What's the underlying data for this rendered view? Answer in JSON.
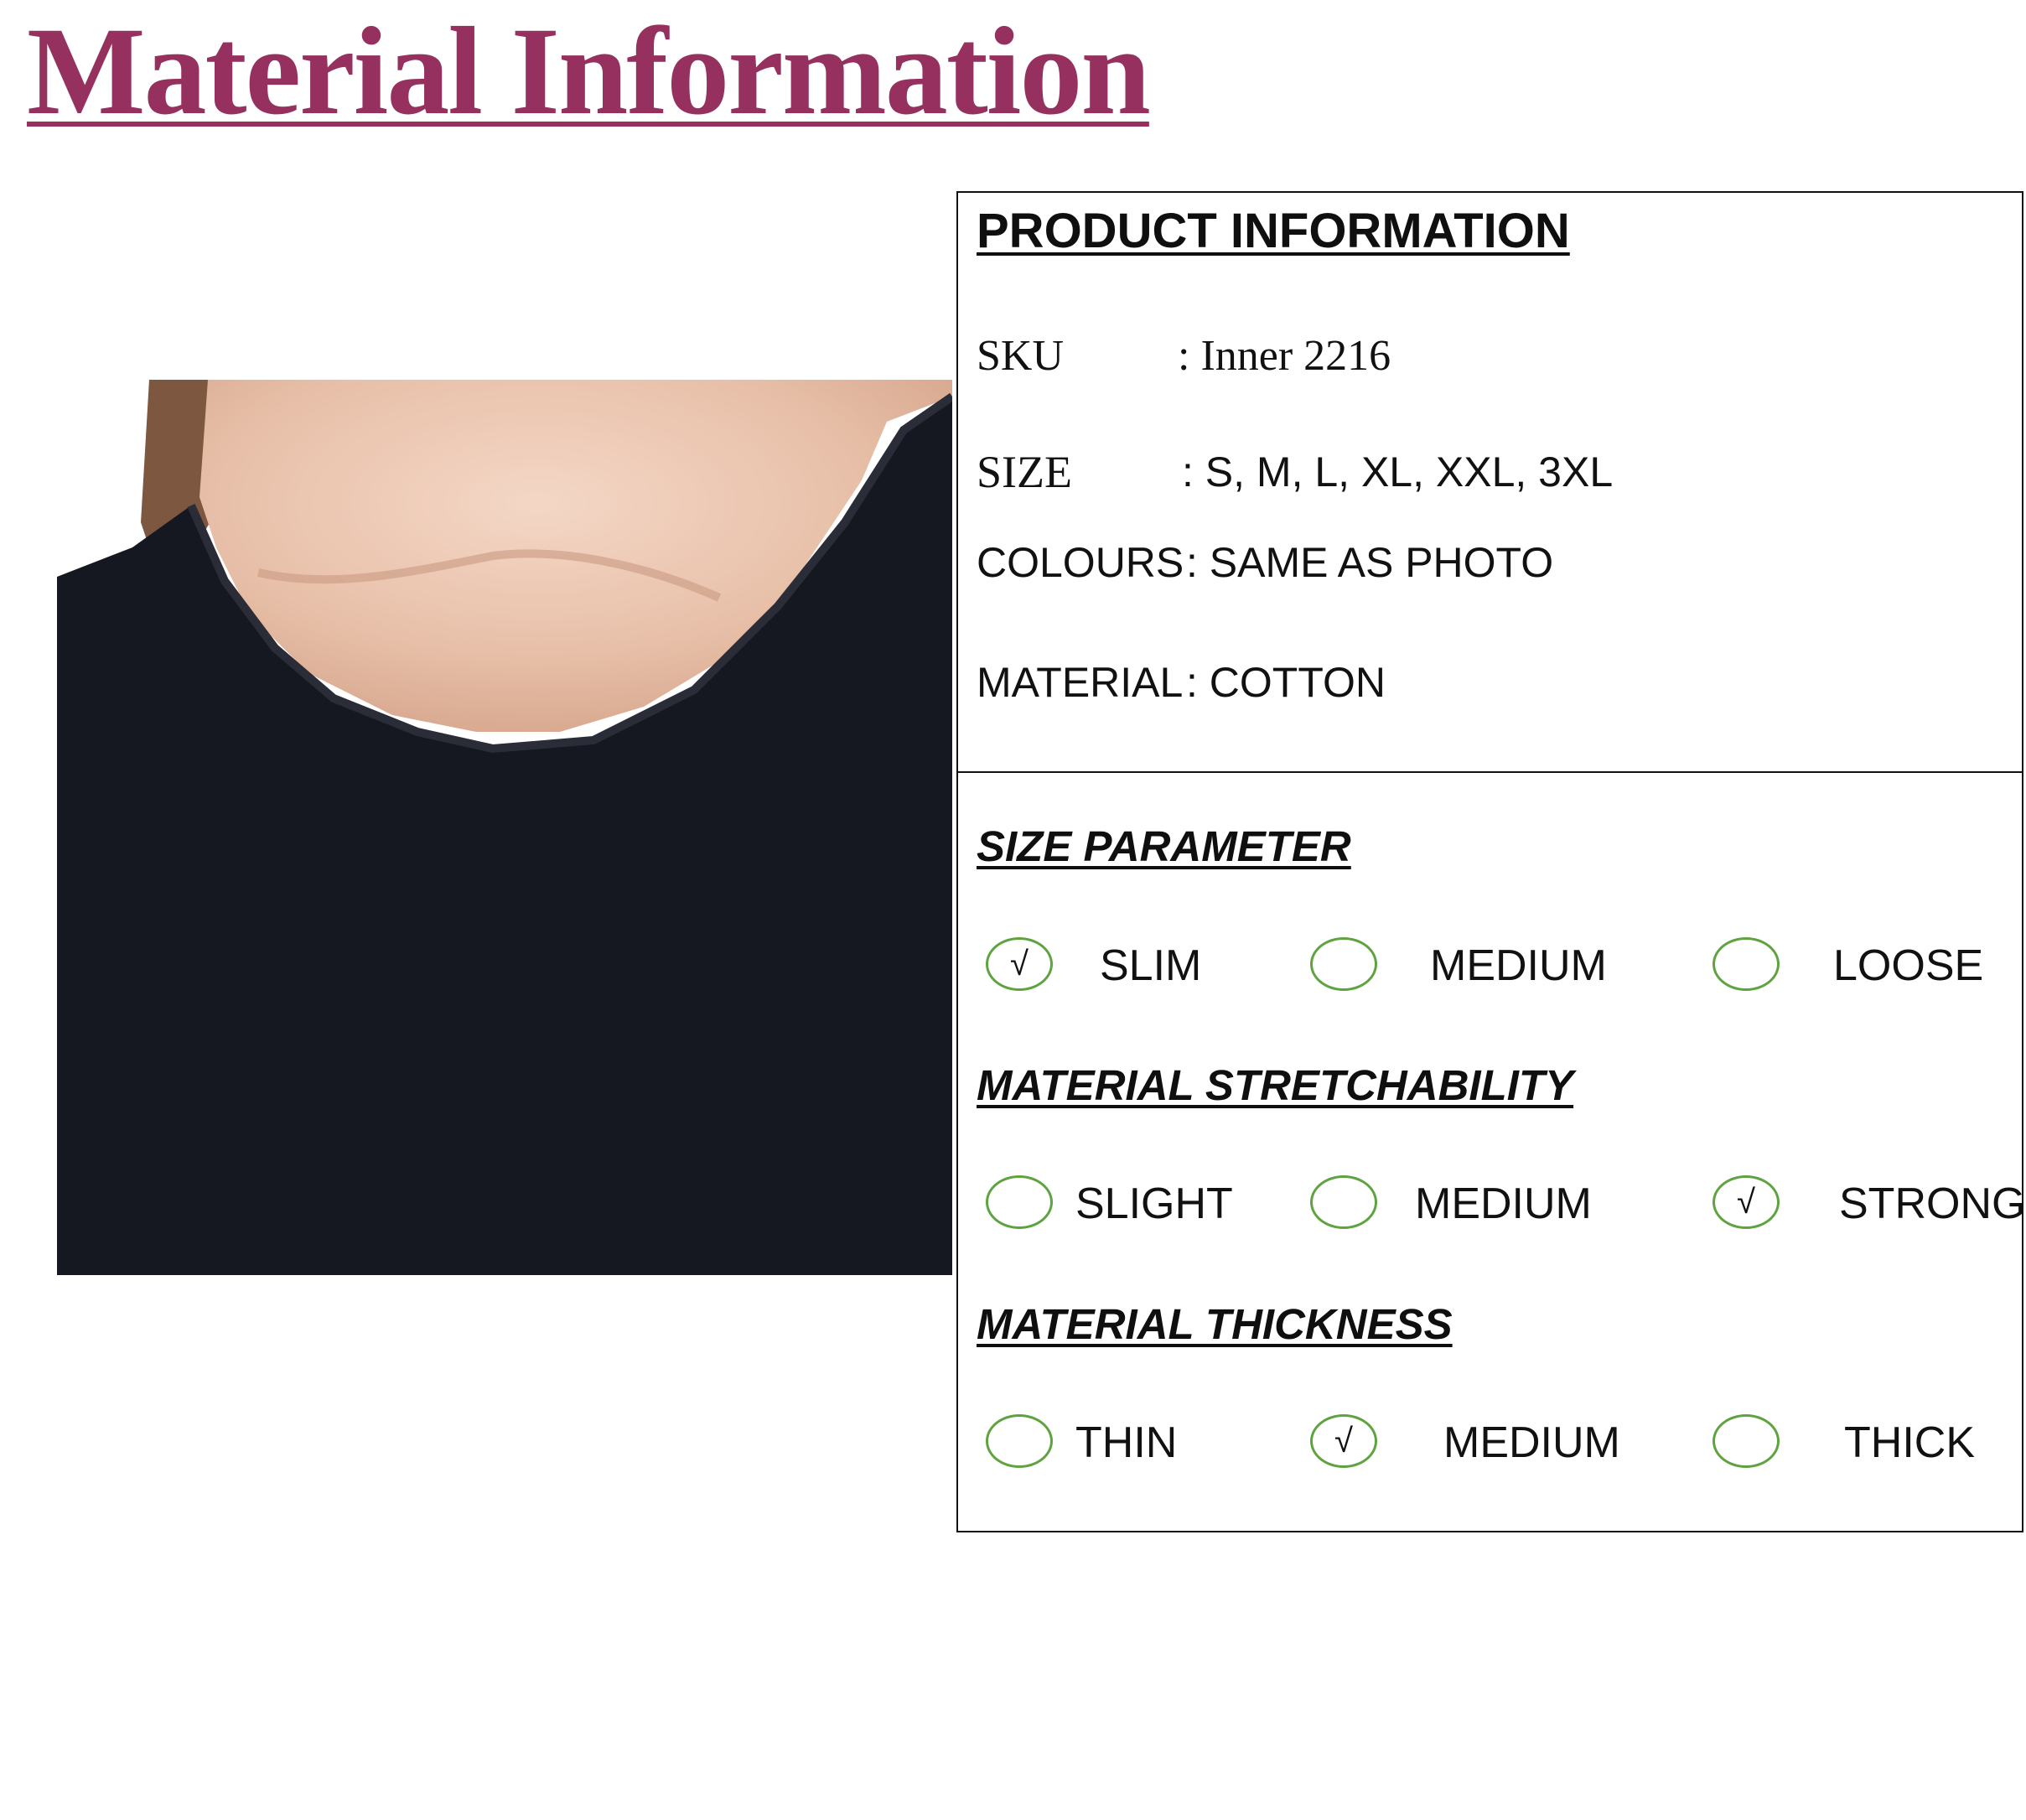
{
  "page_title": "Material Information",
  "photo": {
    "icon": "model-photo-black-top"
  },
  "product_info": {
    "heading": "PRODUCT INFORMATION",
    "sku": {
      "label": "SKU",
      "value": ": Inner 2216"
    },
    "size": {
      "label": "SIZE",
      "value": ": S, M, L, XL, XXL, 3XL"
    },
    "colours": {
      "label": "COLOURS",
      "value": ": SAME AS PHOTO"
    },
    "material": {
      "label": "MATERIAL",
      "value": ": COTTON"
    }
  },
  "size_parameter": {
    "heading": "SIZE PARAMETER",
    "options": [
      {
        "label": "SLIM",
        "mark": "√"
      },
      {
        "label": "MEDIUM",
        "mark": ""
      },
      {
        "label": "LOOSE",
        "mark": ""
      }
    ]
  },
  "stretchability": {
    "heading": "MATERIAL STRETCHABILITY",
    "options": [
      {
        "label": "SLIGHT",
        "mark": ""
      },
      {
        "label": "MEDIUM",
        "mark": ""
      },
      {
        "label": "STRONG",
        "mark": "√"
      }
    ]
  },
  "thickness": {
    "heading": "MATERIAL THICKNESS",
    "options": [
      {
        "label": "THIN",
        "mark": ""
      },
      {
        "label": "MEDIUM",
        "mark": "√"
      },
      {
        "label": "THICK",
        "mark": ""
      }
    ]
  },
  "colors": {
    "title": "#96315f",
    "circle": "#5fa341",
    "garment": "#161821"
  }
}
